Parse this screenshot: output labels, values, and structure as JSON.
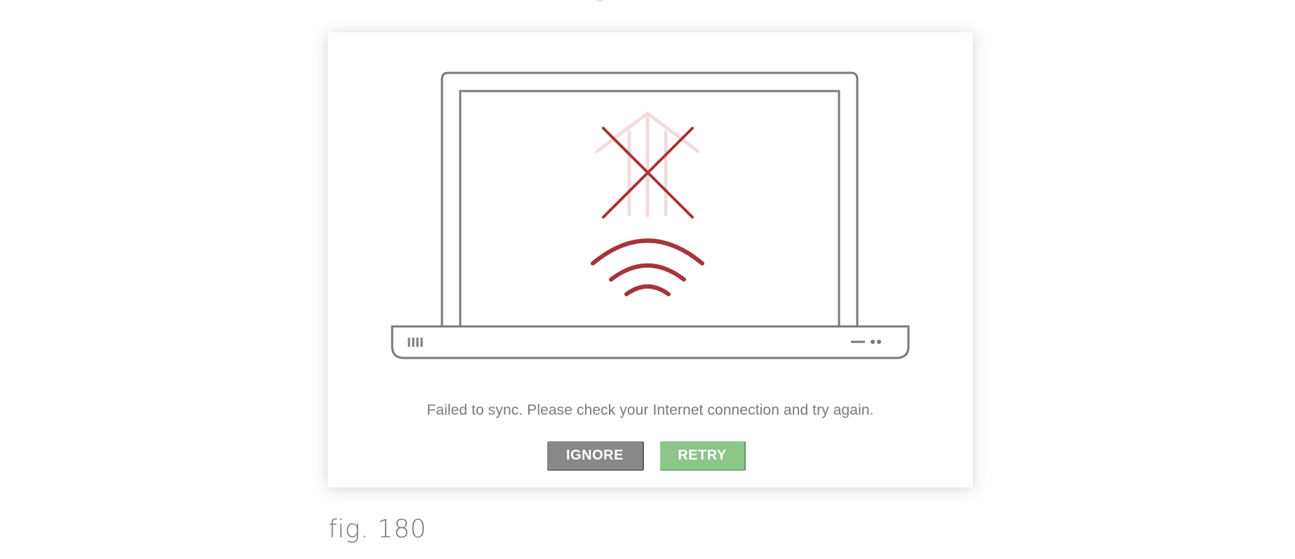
{
  "dialog": {
    "message": "Failed to sync. Please check your Internet connection and try again.",
    "buttons": {
      "ignore_label": "IGNORE",
      "retry_label": "RETRY"
    },
    "colors": {
      "ignore_button": "#888888",
      "retry_button": "#8cc68a",
      "error_icon": "#a8333d",
      "laptop_outline": "#7a7a7a"
    },
    "illustration": {
      "device": "laptop-icon",
      "status_icon": "no-connection-x-icon",
      "signal_icon": "wifi-signal-icon"
    }
  },
  "figure": {
    "caption": "fig. 180"
  }
}
